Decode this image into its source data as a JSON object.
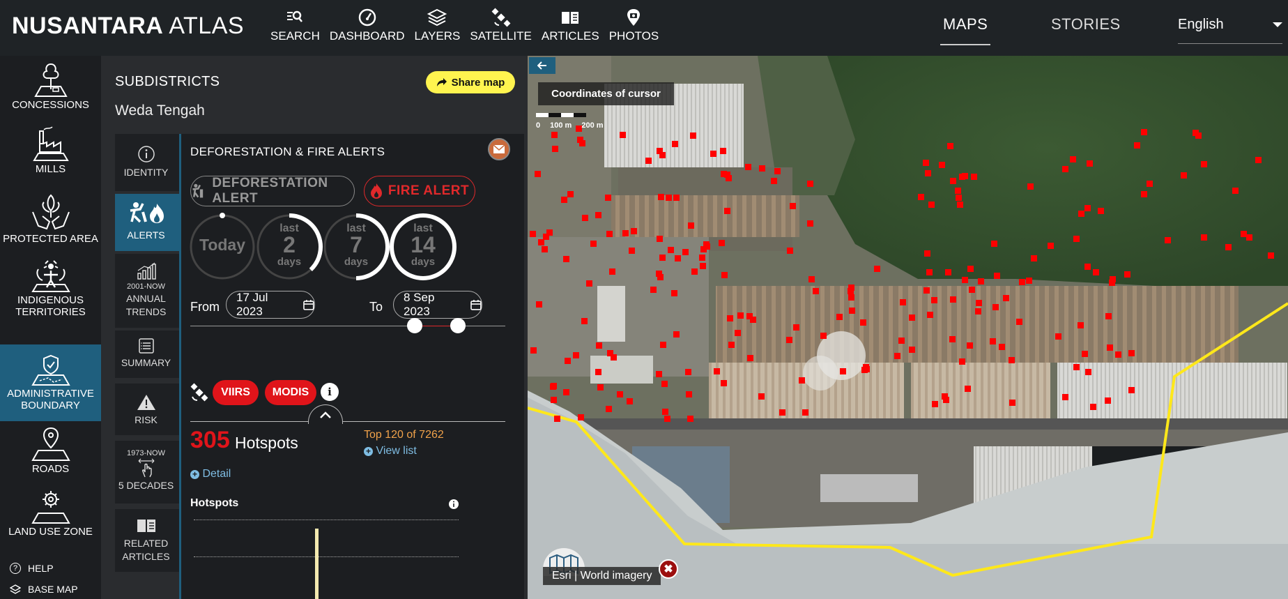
{
  "header": {
    "logo_bold": "NUSANTARA",
    "logo_light": " ATLAS",
    "nav": [
      {
        "label": "SEARCH",
        "icon": "search-icon"
      },
      {
        "label": "DASHBOARD",
        "icon": "dashboard-icon"
      },
      {
        "label": "LAYERS",
        "icon": "layers-icon"
      },
      {
        "label": "SATELLITE",
        "icon": "satellite-icon"
      },
      {
        "label": "ARTICLES",
        "icon": "articles-icon"
      },
      {
        "label": "PHOTOS",
        "icon": "photos-icon"
      }
    ],
    "maps": "MAPS",
    "stories": "STORIES",
    "language": "English"
  },
  "sidebar": {
    "items": [
      {
        "label": "CONCESSIONS"
      },
      {
        "label": "MILLS"
      },
      {
        "label": "PROTECTED AREA"
      },
      {
        "label_1": "INDIGENOUS",
        "label_2": "TERRITORIES"
      },
      {
        "label_1": "ADMINISTRATIVE",
        "label_2": "BOUNDARY"
      },
      {
        "label": "ROADS"
      },
      {
        "label": "LAND USE ZONE"
      }
    ],
    "help": "HELP",
    "base_map": "BASE MAP"
  },
  "panel": {
    "title": "SUBDISTRICTS",
    "subtitle": "Weda Tengah",
    "share": "Share map",
    "tabs": {
      "identity": "IDENTITY",
      "alerts": "ALERTS",
      "trends_top": "2001-NOW",
      "trends_1": "ANNUAL",
      "trends_2": "TRENDS",
      "summary": "SUMMARY",
      "risk": "RISK",
      "decades_top": "1973-NOW",
      "decades": "5 DECADES",
      "related_1": "RELATED",
      "related_2": "ARTICLES"
    }
  },
  "alerts": {
    "title": "DEFORESTATION & FIRE ALERTS",
    "deforestation": "DEFORESTATION ALERT",
    "fire": "FIRE ALERT",
    "rings": [
      {
        "top": "",
        "num": "Today",
        "bottom": "",
        "fraction": 0
      },
      {
        "top": "last",
        "num": "2",
        "bottom": "days",
        "fraction": 0.38
      },
      {
        "top": "last",
        "num": "7",
        "bottom": "days",
        "fraction": 0.5
      },
      {
        "top": "last",
        "num": "14",
        "bottom": "days",
        "fraction": 1
      }
    ],
    "from_label": "From",
    "from_date": "17 Jul 2023",
    "to_label": "To",
    "to_date": "8 Sep 2023",
    "viirs": "VIIRS",
    "modis": "MODIS",
    "info": "i",
    "count": "305",
    "count_label": "Hotspots",
    "detail": "Detail",
    "top": "Top 120 of 7262",
    "view_list": "View list",
    "chart_title": "Hotspots"
  },
  "map": {
    "coordinates": "Coordinates of cursor",
    "scale": [
      "0",
      "100 m",
      "200 m"
    ],
    "attribution": "Esri | World imagery",
    "close": "✖"
  }
}
